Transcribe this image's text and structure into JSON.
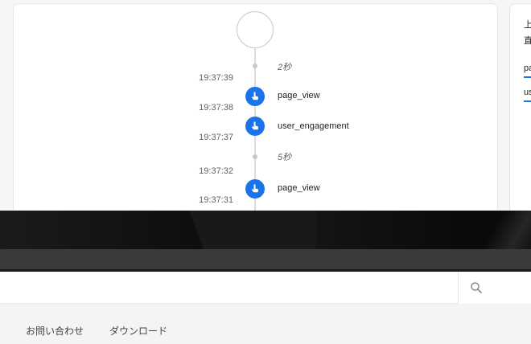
{
  "timeline": {
    "timestamps": [
      "19:37:39",
      "19:37:38",
      "19:37:37",
      "19:37:32",
      "19:37:31"
    ],
    "durations": [
      "2秒",
      "5秒"
    ],
    "events": [
      {
        "label": "page_view",
        "icon": "touch-icon"
      },
      {
        "label": "user_engagement",
        "icon": "touch-icon"
      },
      {
        "label": "page_view",
        "icon": "touch-icon"
      }
    ],
    "accent_color": "#1a73e8"
  },
  "side_panel": {
    "lines": [
      "上",
      "直"
    ],
    "tabs": [
      "pa",
      "us"
    ]
  },
  "site": {
    "nav": [
      "お問い合わせ",
      "ダウンロード"
    ],
    "search_icon": "search-icon"
  }
}
